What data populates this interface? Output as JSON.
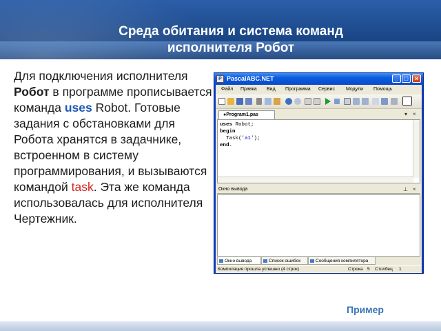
{
  "slide": {
    "title_line1": "Среда обитания и система команд",
    "title_line2": "исполнителя Робот",
    "paragraph": {
      "t1": "Для подключения исполнителя ",
      "robot_bold": "Робот",
      "t2": " в программе прописывается команда ",
      "uses_kw": "uses",
      "t3": " ",
      "robot_plain": "Robot",
      "t4": ". Готовые задания с обстановками для Робота хранятся в задачнике, встроенном в систему программирования, и вызываются командой ",
      "task_kw": "task",
      "t5": ". Эта же команда использовалась для исполнителя Чертежник."
    },
    "example_link": "Пример"
  },
  "ide": {
    "window_title": "PascalABC.NET",
    "window_buttons": {
      "minimize": "_",
      "maximize": "□",
      "close": "×"
    },
    "menu": [
      "Файл",
      "Правка",
      "Вид",
      "Программа",
      "Сервис",
      "Модули",
      "Помощь"
    ],
    "toolbar_icons": [
      "new-icon",
      "open-icon",
      "save-icon",
      "save-all-icon",
      "cut-icon",
      "copy-icon",
      "paste-icon",
      "undo-icon",
      "redo-icon",
      "find-icon",
      "replace-icon",
      "run-icon",
      "stop-icon",
      "debug-icon",
      "step-icon",
      "step-over-icon",
      "output-toggle-icon"
    ],
    "doc_tab": "●Program1.pas",
    "code": {
      "line1_kw": "uses",
      "line1_rest": " Robot;",
      "line2_kw": "begin",
      "line3_pre": "  Task(",
      "line3_str": "'a1'",
      "line3_post": ");",
      "line4_kw": "end."
    },
    "output_title": "Окно вывода",
    "bottom_tabs": [
      "Окно вывода",
      "Список ошибок",
      "Сообщения компилятора"
    ],
    "status": {
      "message": "Компиляция прошла успешно (4 строк)",
      "row_label": "Строка",
      "row_value": "5",
      "col_label": "Столбец",
      "col_value": "1"
    }
  },
  "colors": {
    "header_blue": "#1d4a8c",
    "keyword_blue": "#1f57b8",
    "task_red": "#d6231f",
    "xp_titlebar": "#0b5de0"
  }
}
